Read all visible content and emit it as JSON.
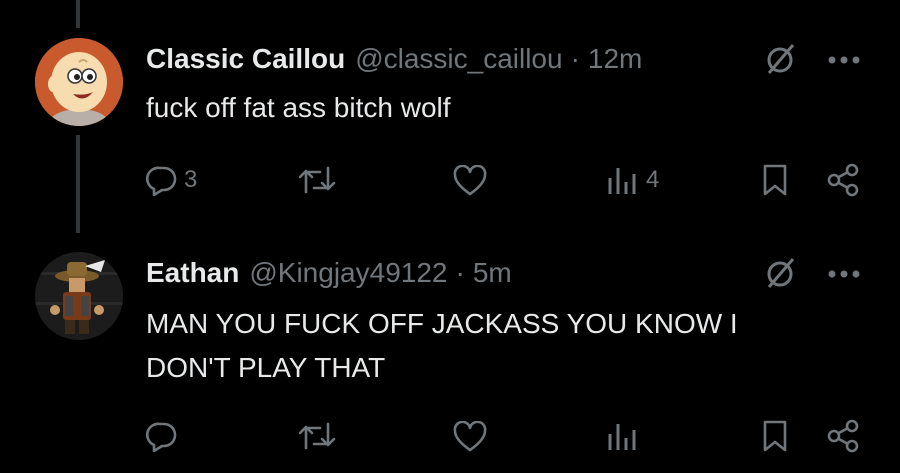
{
  "tweets": [
    {
      "name": "Classic Caillou",
      "handle": "@classic_caillou",
      "separator": "·",
      "time": "12m",
      "text": "fuck off fat ass bitch wolf",
      "replies": "3",
      "views": "4",
      "avatar_icon": "caillou-cartoon-avatar"
    },
    {
      "name": "Eathan",
      "handle": "@Kingjay49122",
      "separator": "·",
      "time": "5m",
      "text": "MAN YOU FUCK OFF JACKASS YOU KNOW I DON'T PLAY THAT",
      "replies": "",
      "views": "",
      "avatar_icon": "cowboy-character-avatar"
    }
  ],
  "colors": {
    "background": "#000000",
    "text": "#e7e9ea",
    "muted": "#71767b",
    "thread_line": "#333639"
  }
}
